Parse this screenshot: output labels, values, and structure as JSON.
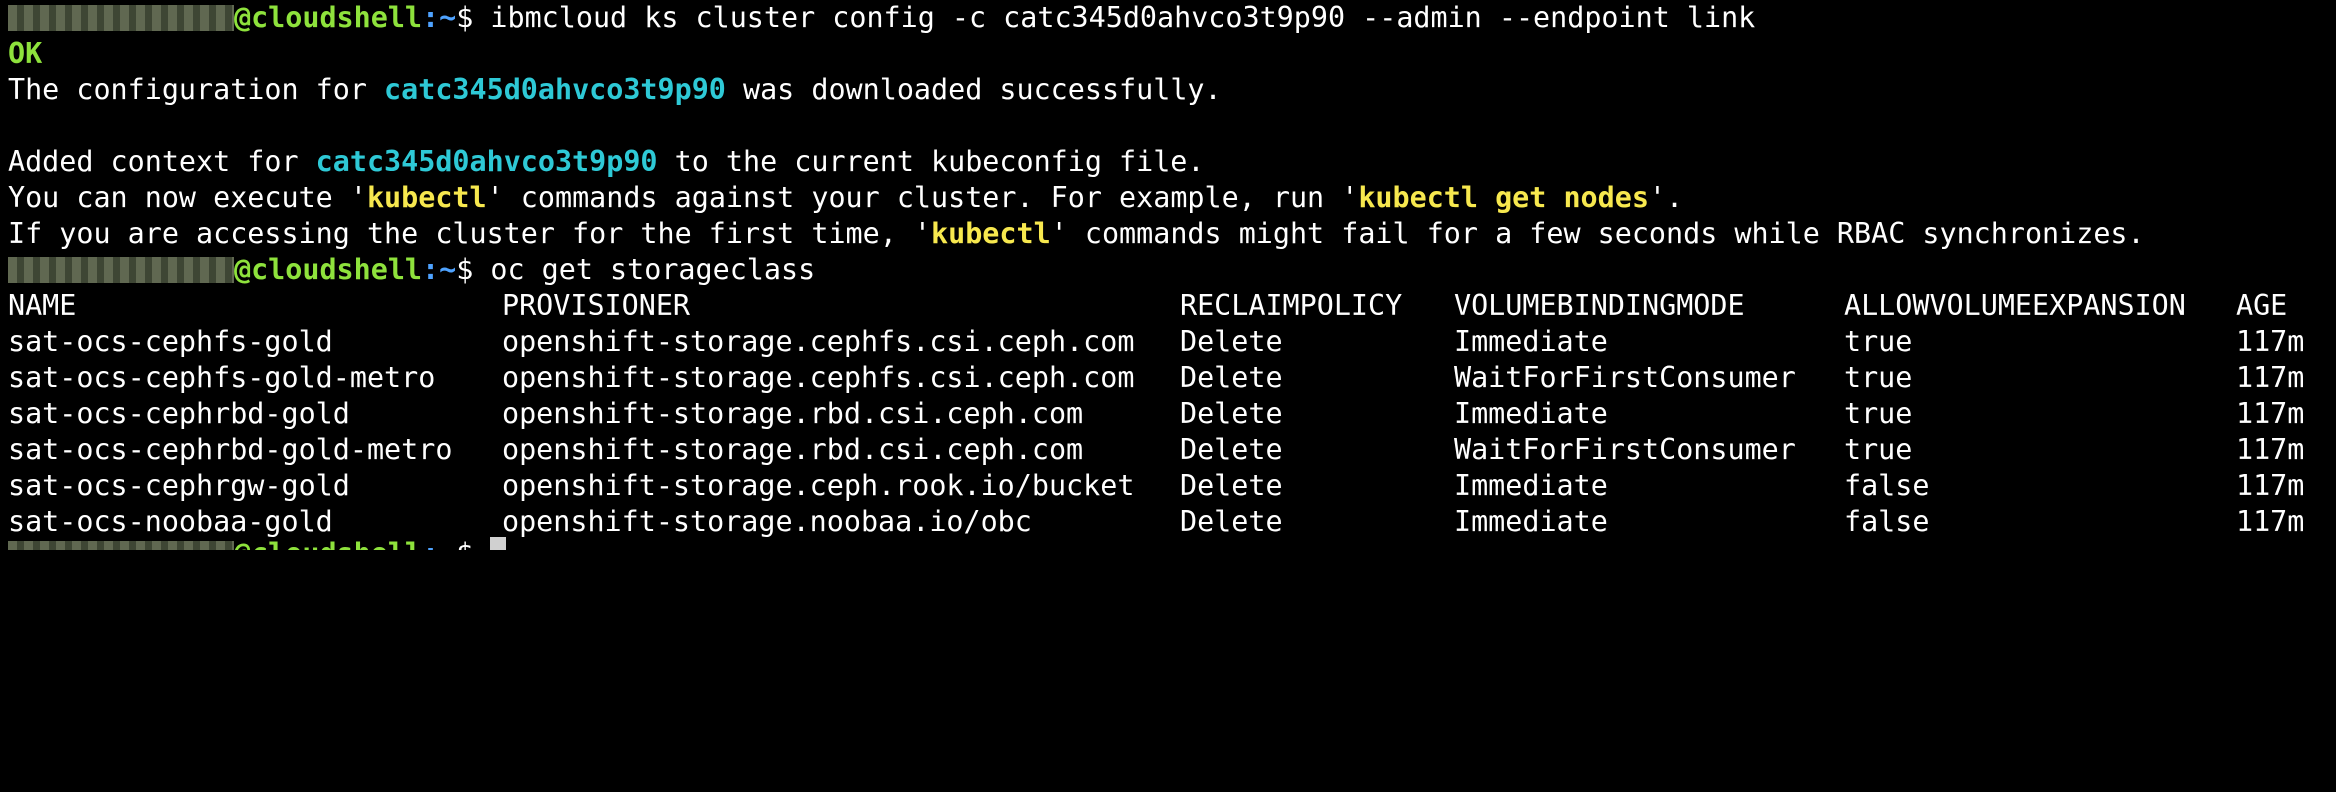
{
  "prompt": {
    "host_suffix": "@cloudshell",
    "path": ":~",
    "sign": "$"
  },
  "commands": {
    "cmd1": " ibmcloud ks cluster config -c catc345d0ahvco3t9p90 --admin --endpoint link",
    "cmd2": " oc get storageclass"
  },
  "output": {
    "ok": "OK",
    "line1_pre": "The configuration for ",
    "cluster_id": "catc345d0ahvco3t9p90",
    "line1_post": " was downloaded successfully.",
    "line2_pre": "Added context for ",
    "line2_post": " to the current kubeconfig file.",
    "line3_pre": "You can now execute '",
    "kubectl": "kubectl",
    "line3_mid": "' commands against your cluster. For example, run '",
    "kubectl_get_nodes": "kubectl get nodes",
    "line3_post": "'.",
    "line4_pre": "If you are accessing the cluster for the first time, '",
    "line4_post": "' commands might fail for a few seconds while RBAC synchronizes."
  },
  "table": {
    "headers": [
      "NAME",
      "PROVISIONER",
      "RECLAIMPOLICY",
      "VOLUMEBINDINGMODE",
      "ALLOWVOLUMEEXPANSION",
      "AGE"
    ],
    "rows": [
      [
        "sat-ocs-cephfs-gold",
        "openshift-storage.cephfs.csi.ceph.com",
        "Delete",
        "Immediate",
        "true",
        "117m"
      ],
      [
        "sat-ocs-cephfs-gold-metro",
        "openshift-storage.cephfs.csi.ceph.com",
        "Delete",
        "WaitForFirstConsumer",
        "true",
        "117m"
      ],
      [
        "sat-ocs-cephrbd-gold",
        "openshift-storage.rbd.csi.ceph.com",
        "Delete",
        "Immediate",
        "true",
        "117m"
      ],
      [
        "sat-ocs-cephrbd-gold-metro",
        "openshift-storage.rbd.csi.ceph.com",
        "Delete",
        "WaitForFirstConsumer",
        "true",
        "117m"
      ],
      [
        "sat-ocs-cephrgw-gold",
        "openshift-storage.ceph.rook.io/bucket",
        "Delete",
        "Immediate",
        "false",
        "117m"
      ],
      [
        "sat-ocs-noobaa-gold",
        "openshift-storage.noobaa.io/obc",
        "Delete",
        "Immediate",
        "false",
        "117m"
      ]
    ]
  },
  "colors": {
    "background": "#000000",
    "host_green": "#8ee23c",
    "path_blue": "#4fa3ff",
    "cluster_cyan": "#2ec9d6",
    "kubectl_yellow": "#f7e84e"
  }
}
